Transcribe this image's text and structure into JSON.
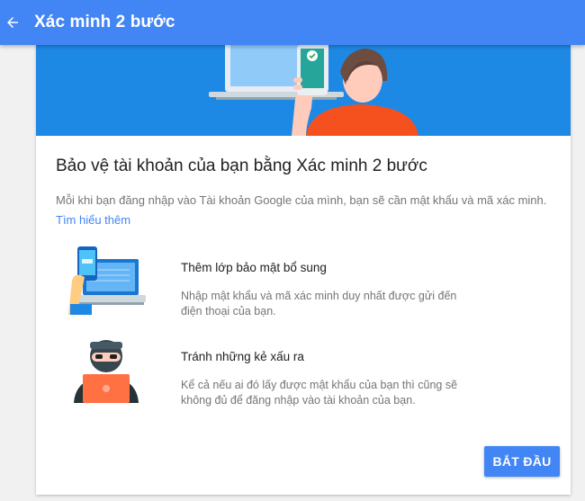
{
  "appbar": {
    "back_icon": "arrow-back-icon",
    "title": "Xác minh 2 bước"
  },
  "intro": {
    "heading": "Bảo vệ tài khoản của bạn bằng Xác minh 2 bước",
    "description": "Mỗi khi bạn đăng nhập vào Tài khoản Google của mình, bạn sẽ cần mật khẩu và mã xác minh.",
    "learn_more": "Tìm hiểu thêm"
  },
  "features": [
    {
      "icon": "phone-laptop-icon",
      "title": "Thêm lớp bảo mật bổ sung",
      "description": "Nhập mật khẩu và mã xác minh duy nhất được gửi đến điện thoại của bạn."
    },
    {
      "icon": "hacker-icon",
      "title": "Tránh những kẻ xấu ra",
      "description": "Kể cả nếu ai đó lấy được mật khẩu của bạn thì cũng sẽ không đủ để đăng nhập vào tài khoản của bạn."
    }
  ],
  "actions": {
    "start_label": "BẮT ĐẦU"
  },
  "colors": {
    "primary": "#4285f4",
    "hero_bg": "#1e88e5",
    "accent_orange": "#f4511e",
    "check_green": "#34a853"
  }
}
